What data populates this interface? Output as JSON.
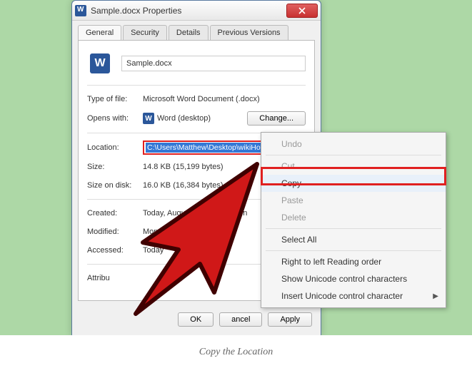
{
  "window": {
    "title": "Sample.docx Properties",
    "tabs": [
      "General",
      "Security",
      "Details",
      "Previous Versions"
    ],
    "filename": "Sample.docx",
    "rows": {
      "type_label": "Type of file:",
      "type_value": "Microsoft Word Document (.docx)",
      "opens_label": "Opens with:",
      "opens_value": "Word (desktop)",
      "change_btn": "Change...",
      "location_label": "Location:",
      "location_value": "C:\\Users\\Matthew\\Desktop\\wikiHow",
      "size_label": "Size:",
      "size_value": "14.8 KB (15,199 bytes)",
      "sod_label": "Size on disk:",
      "sod_value": "16.0 KB (16,384 bytes)",
      "created_label": "Created:",
      "created_value": "Today, August 11, 2016, 1 min",
      "modified_label": "Modified:",
      "modified_value": "Monday, December",
      "accessed_label": "Accessed:",
      "accessed_value": "Today",
      "attributes_label": "Attribu"
    },
    "buttons": {
      "ok": "OK",
      "cancel": "ancel",
      "apply": "Apply"
    }
  },
  "context_menu": {
    "undo": "Undo",
    "cut": "Cut",
    "copy": "Copy",
    "paste": "Paste",
    "delete": "Delete",
    "select_all": "Select All",
    "rtl": "Right to left Reading order",
    "show_uni": "Show Unicode control characters",
    "insert_uni": "Insert Unicode control character"
  },
  "caption": "Copy the Location"
}
